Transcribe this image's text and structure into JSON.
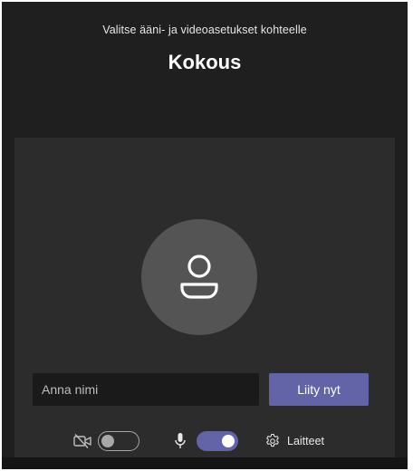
{
  "header": {
    "subtitle": "Valitse ääni- ja videoasetukset kohteelle",
    "title": "Kokous"
  },
  "avatar": {
    "icon": "person-icon"
  },
  "join": {
    "name_placeholder": "Anna nimi",
    "name_value": "",
    "join_label": "Liity nyt"
  },
  "controls": {
    "camera": {
      "icon": "camera-off-icon",
      "enabled": false
    },
    "microphone": {
      "icon": "microphone-icon",
      "enabled": true
    },
    "devices": {
      "icon": "gear-icon",
      "label": "Laitteet"
    }
  },
  "colors": {
    "background": "#1f1f1f",
    "stage": "#2d2c2c",
    "accent": "#6264a7",
    "avatar": "#545454",
    "input": "#1a1a1a"
  }
}
